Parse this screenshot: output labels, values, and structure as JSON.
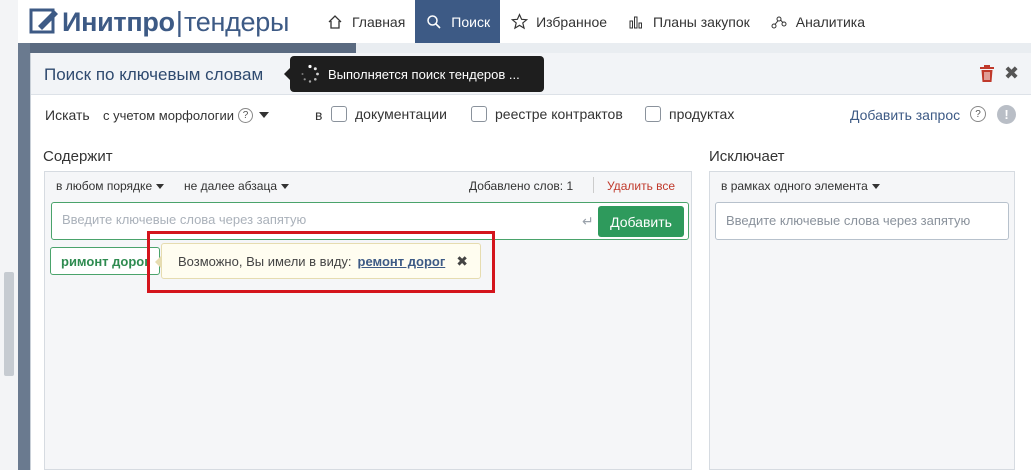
{
  "brand": {
    "name_bold": "Инитпро",
    "name_sep": "|",
    "name_light": "тендеры"
  },
  "nav": [
    {
      "label": "Главная",
      "icon": "home-icon"
    },
    {
      "label": "Поиск",
      "icon": "search-icon",
      "active": true
    },
    {
      "label": "Избранное",
      "icon": "star-icon"
    },
    {
      "label": "Планы закупок",
      "icon": "bar-chart-icon"
    },
    {
      "label": "Аналитика",
      "icon": "analytics-icon"
    }
  ],
  "modal": {
    "title": "Поиск по ключевым словам",
    "toast": "Выполняется поиск тендеров ...",
    "close": "✖"
  },
  "search_row": {
    "label": "Искать",
    "mode": "с учетом морфологии",
    "help": "?",
    "in_label": "в",
    "checkboxes": [
      {
        "label": "документации",
        "checked": false
      },
      {
        "label": "реестре контрактов",
        "checked": false
      },
      {
        "label": "продуктах",
        "checked": false
      }
    ],
    "add_query": "Добавить запрос",
    "help2": "?",
    "warn": "!"
  },
  "contains": {
    "title": "Содержит",
    "order": "в любом порядке",
    "distance": "не далее абзаца",
    "words_added": "Добавлено слов: 1",
    "delete_all": "Удалить все",
    "placeholder": "Введите ключевые слова через запятую",
    "enter_glyph": "↵",
    "add_button": "Добавить",
    "chip": "римонт дорог",
    "suggestion_prefix": "Возможно, Вы имели в виду:",
    "suggestion_link": "ремонт дорог",
    "suggestion_close": "✖"
  },
  "excludes": {
    "title": "Исключает",
    "scope": "в рамках одного элемента",
    "placeholder": "Введите ключевые слова через запятую"
  },
  "colors": {
    "brand": "#3d5a85",
    "accent_green": "#2e9a5c",
    "danger": "#c0392b",
    "highlight": "#d4141c"
  }
}
